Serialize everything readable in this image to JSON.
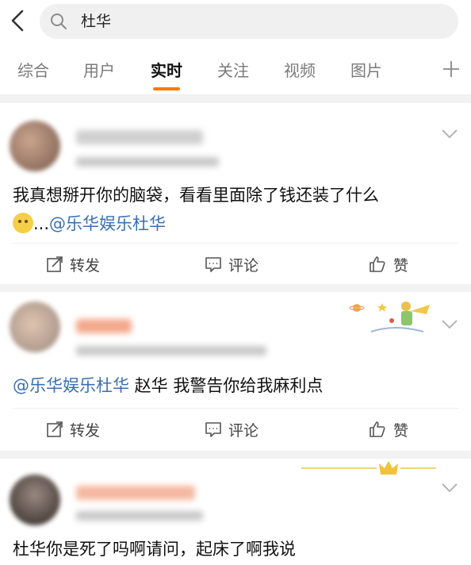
{
  "search": {
    "query": "杜华"
  },
  "tabs": [
    {
      "label": "综合"
    },
    {
      "label": "用户"
    },
    {
      "label": "实时"
    },
    {
      "label": "关注"
    },
    {
      "label": "视频"
    },
    {
      "label": "图片"
    }
  ],
  "posts": [
    {
      "text_before": "我真想掰开你的脑袋，看看里面除了钱还装了什么",
      "text_after": "...",
      "mention": "@乐华娱乐杜华",
      "actions": {
        "repost": "转发",
        "comment": "评论",
        "like": "赞"
      }
    },
    {
      "mention": "@乐华娱乐杜华",
      "text": " 赵华 我警告你给我麻利点",
      "actions": {
        "repost": "转发",
        "comment": "评论",
        "like": "赞"
      }
    },
    {
      "text": "杜华你是死了吗啊请问，起床了啊我说"
    }
  ],
  "colors": {
    "accent": "#ff7a00",
    "link": "#3b6fb0"
  }
}
